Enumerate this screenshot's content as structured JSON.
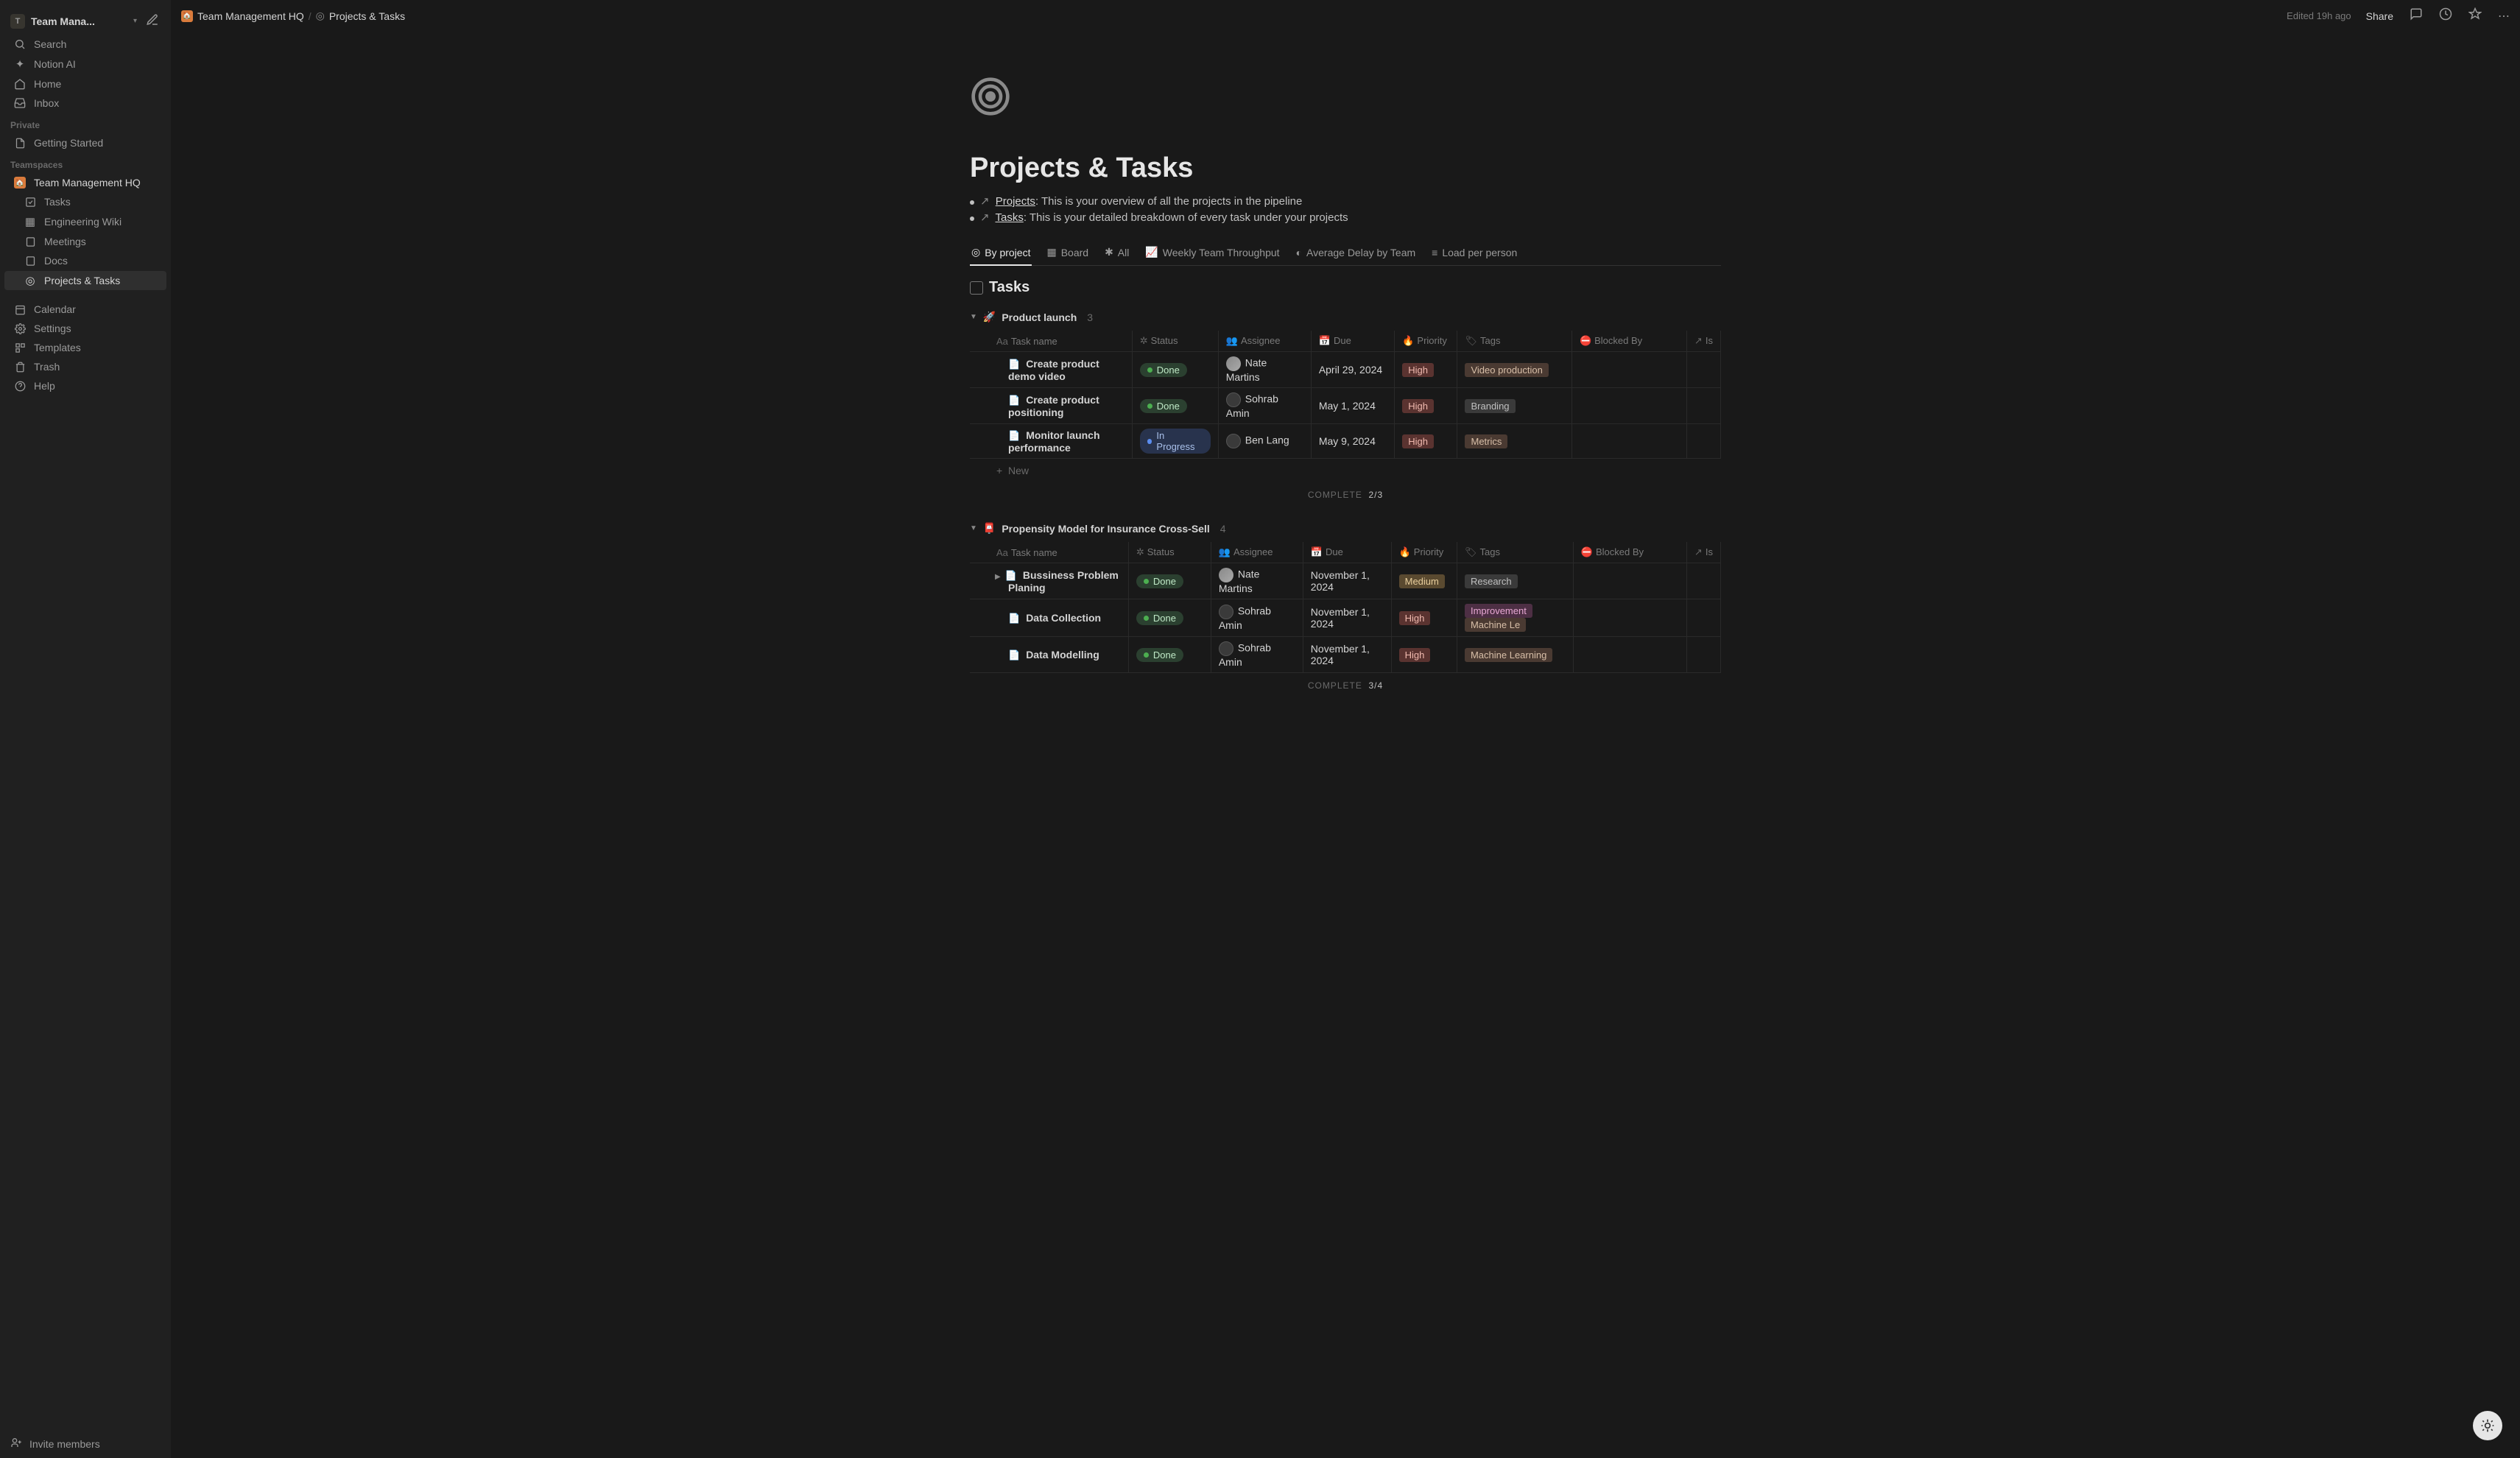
{
  "workspace": {
    "badge": "T",
    "name": "Team Mana..."
  },
  "sidebar": {
    "search": "Search",
    "ai": "Notion AI",
    "home": "Home",
    "inbox": "Inbox",
    "private_label": "Private",
    "getting_started": "Getting Started",
    "teamspaces_label": "Teamspaces",
    "hq": "Team Management HQ",
    "items": [
      "Tasks",
      "Engineering Wiki",
      "Meetings",
      "Docs",
      "Projects & Tasks"
    ],
    "calendar": "Calendar",
    "settings": "Settings",
    "templates": "Templates",
    "trash": "Trash",
    "help": "Help",
    "invite": "Invite members"
  },
  "topbar": {
    "crumb1": "Team Management HQ",
    "crumb2": "Projects & Tasks",
    "edited": "Edited 19h ago",
    "share": "Share"
  },
  "page": {
    "title": "Projects & Tasks",
    "desc1_link": "Projects",
    "desc1_rest": ": This is your overview of all the projects in the pipeline",
    "desc2_link": "Tasks",
    "desc2_rest": ": This is your detailed breakdown of every task under your projects",
    "db_title": "Tasks"
  },
  "tabs": [
    "By project",
    "Board",
    "All",
    "Weekly Team Throughput",
    "Average Delay by Team",
    "Load per person"
  ],
  "headers": {
    "name": "Task name",
    "status": "Status",
    "assignee": "Assignee",
    "due": "Due",
    "priority": "Priority",
    "tags": "Tags",
    "blocked": "Blocked By",
    "is": "Is"
  },
  "groups": [
    {
      "emoji": "🚀",
      "name": "Product launch",
      "count": "3",
      "rows": [
        {
          "name": "Create product demo video",
          "status": "Done",
          "assignee": "Nate Martins",
          "av": "img",
          "due": "April 29, 2024",
          "pri": "High",
          "tags": [
            {
              "t": "Video production",
              "c": "brown"
            }
          ]
        },
        {
          "name": "Create product positioning",
          "status": "Done",
          "assignee": "Sohrab Amin",
          "av": "gray",
          "due": "May 1, 2024",
          "pri": "High",
          "tags": [
            {
              "t": "Branding",
              "c": "default"
            }
          ]
        },
        {
          "name": "Monitor launch performance",
          "status": "In Progress",
          "assignee": "Ben Lang",
          "av": "gray",
          "due": "May 9, 2024",
          "pri": "High",
          "tags": [
            {
              "t": "Metrics",
              "c": "brown"
            }
          ]
        }
      ],
      "new": "New",
      "complete_label": "COMPLETE",
      "complete_val": "2/3"
    },
    {
      "emoji": "📮",
      "name": "Propensity Model for Insurance Cross-Sell",
      "count": "4",
      "rows": [
        {
          "name": "Bussiness Problem Planing",
          "status": "Done",
          "assignee": "Nate Martins",
          "av": "img",
          "due": "November 1, 2024",
          "pri": "Medium",
          "tags": [
            {
              "t": "Research",
              "c": "default"
            }
          ],
          "expand": true
        },
        {
          "name": "Data Collection",
          "status": "Done",
          "assignee": "Sohrab Amin",
          "av": "gray",
          "due": "November 1, 2024",
          "pri": "High",
          "tags": [
            {
              "t": "Improvement",
              "c": "pink"
            },
            {
              "t": "Machine Le",
              "c": "brown"
            }
          ]
        },
        {
          "name": "Data Modelling",
          "status": "Done",
          "assignee": "Sohrab Amin",
          "av": "gray",
          "due": "November 1, 2024",
          "pri": "High",
          "tags": [
            {
              "t": "Machine Learning",
              "c": "brown"
            }
          ]
        }
      ],
      "complete_label": "COMPLETE",
      "complete_val": "3/4"
    }
  ]
}
